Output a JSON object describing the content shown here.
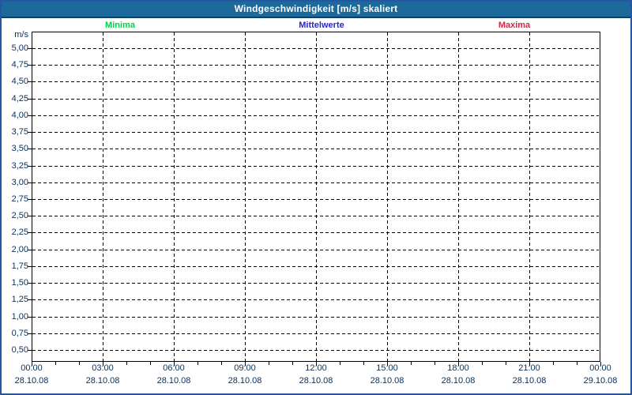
{
  "window": {
    "title": "Windgeschwindigkeit [m/s] skaliert"
  },
  "colors": {
    "titlebar": "#1c699c",
    "titlebar_border": "#103f63",
    "frame_border": "#2456a4",
    "axis_text": "#0a3055",
    "grid": "#000000",
    "minima": "#00d24a",
    "mittelwerte": "#2727cf",
    "maxima": "#c62b49"
  },
  "chart_data": {
    "type": "line",
    "title": "Windgeschwindigkeit [m/s] skaliert",
    "grid": "dashed",
    "legend_position": "top",
    "series": [
      {
        "name": "Minima",
        "color": "#00d24a",
        "values": []
      },
      {
        "name": "Mittelwerte",
        "color": "#2727cf",
        "values": []
      },
      {
        "name": "Maxima",
        "color": "#c62b49",
        "values": []
      }
    ],
    "y_axis": {
      "unit": "m/s",
      "min": 0.5,
      "max": 5.0,
      "step": 0.25,
      "tick_labels": [
        "5,00",
        "4,75",
        "4,50",
        "4,25",
        "4,00",
        "3,75",
        "3,50",
        "3,25",
        "3,00",
        "2,75",
        "2,50",
        "2,25",
        "2,00",
        "1,75",
        "1,50",
        "1,25",
        "1,00",
        "0,75",
        "0,50"
      ]
    },
    "x_axis": {
      "tick_times": [
        "00:00",
        "03:00",
        "06:00",
        "09:00",
        "12:00",
        "15:00",
        "18:00",
        "21:00",
        "00:00"
      ],
      "tick_dates": [
        "28.10.08",
        "28.10.08",
        "28.10.08",
        "28.10.08",
        "28.10.08",
        "28.10.08",
        "28.10.08",
        "28.10.08",
        "29.10.08"
      ],
      "minor_ticks_per_major": 3
    }
  }
}
